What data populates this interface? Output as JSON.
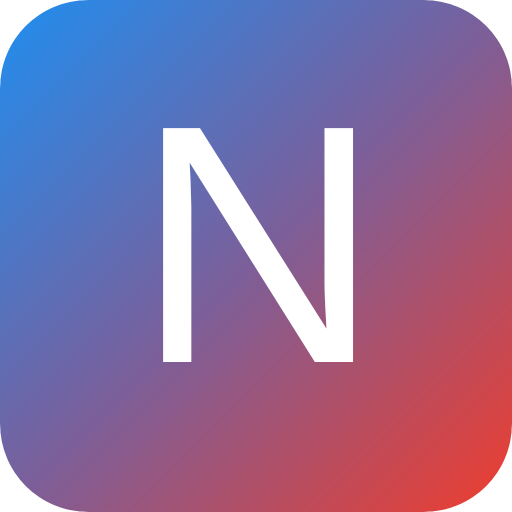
{
  "app_icon": {
    "letter": "N",
    "icon_name": "app-logo-icon",
    "colors": {
      "gradient_start": "#1f8ef0",
      "gradient_mid": "#7b5f9a",
      "gradient_end": "#ef3d2d",
      "letter": "#ffffff"
    }
  }
}
